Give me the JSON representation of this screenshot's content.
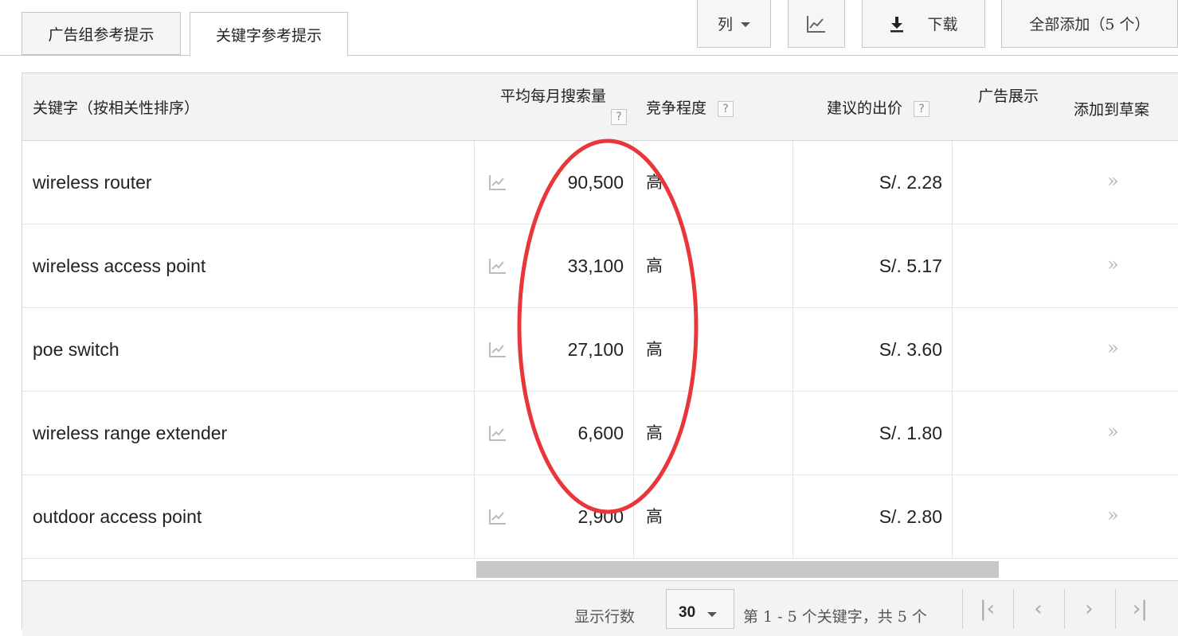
{
  "tabs": [
    {
      "label": "广告组参考提示",
      "active": false
    },
    {
      "label": "关键字参考提示",
      "active": true
    }
  ],
  "toolbar": {
    "columns_label": "列",
    "download_label": "下载",
    "add_all_label": "全部添加（5 个）"
  },
  "table": {
    "headers": {
      "keyword": "关键字（按相关性排序）",
      "avg_monthly": "平均每月搜索量",
      "competition": "竞争程度",
      "suggested_bid": "建议的出价",
      "ad_share": "广告展示",
      "add_to_draft": "添加到草案"
    },
    "help_glyph": "?",
    "rows": [
      {
        "keyword": "wireless router",
        "volume": "90,500",
        "competition": "高",
        "bid": "S/. 2.28"
      },
      {
        "keyword": "wireless access point",
        "volume": "33,100",
        "competition": "高",
        "bid": "S/. 5.17"
      },
      {
        "keyword": "poe switch",
        "volume": "27,100",
        "competition": "高",
        "bid": "S/. 3.60"
      },
      {
        "keyword": "wireless range extender",
        "volume": "6,600",
        "competition": "高",
        "bid": "S/. 1.80"
      },
      {
        "keyword": "outdoor access point",
        "volume": "2,900",
        "competition": "高",
        "bid": "S/. 2.80"
      }
    ],
    "add_glyph": "»"
  },
  "footer": {
    "rows_label": "显示行数",
    "rows_value": "30",
    "range_text": "第 1 - 5 个关键字，共 5 个"
  },
  "colors": {
    "annotation_ring": "#e8363a",
    "header_bg": "#f3f3f3",
    "border": "#c6c6c6"
  },
  "icons": [
    "chart-icon",
    "download-icon",
    "chevron-down-icon",
    "help-icon",
    "double-chevron-right-icon",
    "first-page-icon",
    "prev-page-icon",
    "next-page-icon",
    "last-page-icon"
  ]
}
